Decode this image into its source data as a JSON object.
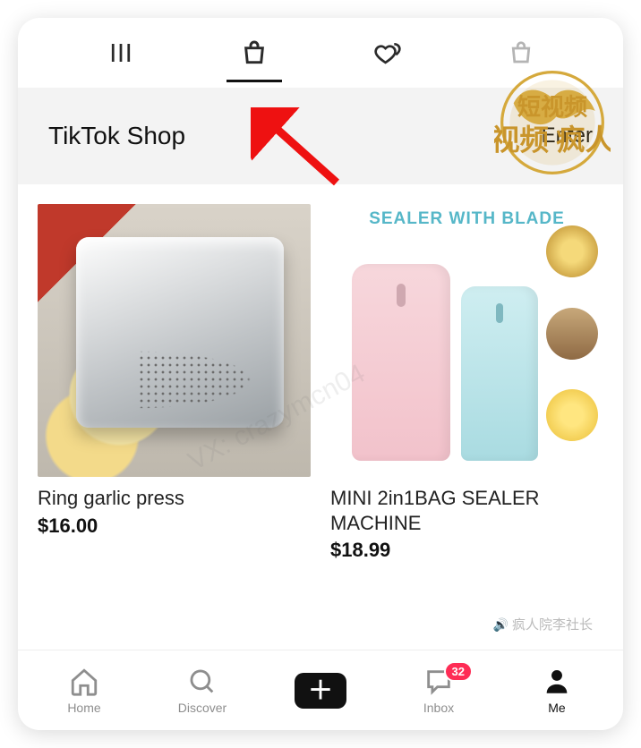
{
  "top_tabs": {
    "left_icon": "feed-icon",
    "center_icon": "shop-bag-icon",
    "right_icon": "heart-hands-icon",
    "far_right_icon": "shop-bag-outline-icon",
    "active_index": 1
  },
  "banner": {
    "title": "TikTok Shop",
    "enter_label": "Enter"
  },
  "products": [
    {
      "title": "Ring garlic press",
      "price": "$16.00",
      "image_kind": "garlic"
    },
    {
      "title": "MINI 2in1BAG SEALER MACHINE",
      "price": "$18.99",
      "image_kind": "sealer",
      "overlay_text": "SEALER WITH BLADE"
    }
  ],
  "bottom_nav": {
    "items": [
      {
        "label": "Home",
        "icon": "home-icon",
        "active": false
      },
      {
        "label": "Discover",
        "icon": "search-icon",
        "active": false
      },
      {
        "label": "",
        "icon": "create-icon",
        "active": false,
        "is_create": true
      },
      {
        "label": "Inbox",
        "icon": "inbox-icon",
        "active": false,
        "badge": "32"
      },
      {
        "label": "Me",
        "icon": "profile-icon",
        "active": true
      }
    ]
  },
  "watermark": {
    "center_text": "VX: crazymcn04",
    "footer_text": "疯人院李社长",
    "seal_text": "短视频 疯人院"
  }
}
